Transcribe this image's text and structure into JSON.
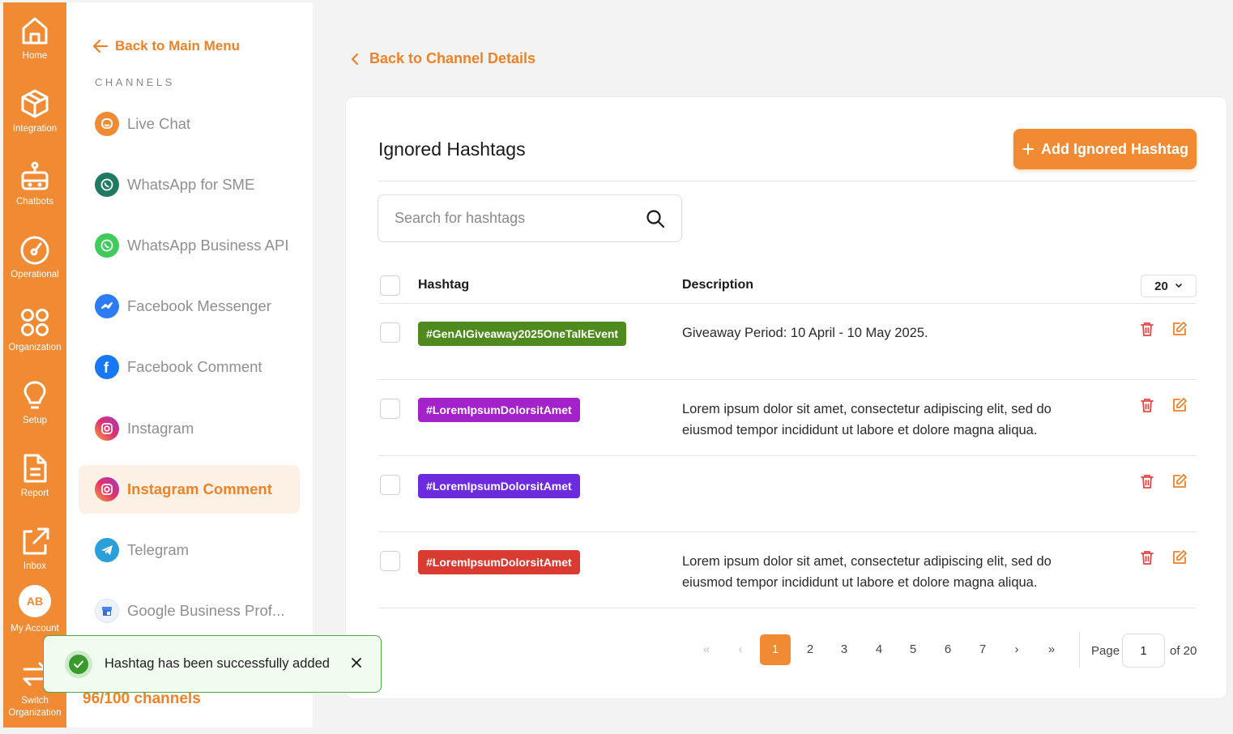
{
  "rail": {
    "items": [
      {
        "label": "Home",
        "icon": "home-icon"
      },
      {
        "label": "Integration",
        "icon": "cube-icon"
      },
      {
        "label": "Chatbots",
        "icon": "robot-icon"
      },
      {
        "label": "Operational",
        "icon": "gauge-icon"
      },
      {
        "label": "Organization",
        "icon": "circles-icon"
      },
      {
        "label": "Setup",
        "icon": "lightbulb-icon"
      },
      {
        "label": "Report",
        "icon": "document-icon"
      },
      {
        "label": "Inbox",
        "icon": "external-link-icon"
      }
    ],
    "account": {
      "initials": "AB",
      "label": "My Account"
    },
    "switch_org": {
      "line1": "Switch",
      "line2": "Organization"
    }
  },
  "panel": {
    "back_label": "Back to Main Menu",
    "section_title": "CHANNELS",
    "channels": [
      {
        "label": "Live Chat",
        "icon": "live-chat-icon"
      },
      {
        "label": "WhatsApp for SME",
        "icon": "whatsapp-sme-icon"
      },
      {
        "label": "WhatsApp Business API",
        "icon": "whatsapp-api-icon"
      },
      {
        "label": "Facebook Messenger",
        "icon": "messenger-icon"
      },
      {
        "label": "Facebook Comment",
        "icon": "facebook-icon"
      },
      {
        "label": "Instagram",
        "icon": "instagram-icon"
      },
      {
        "label": "Instagram Comment",
        "icon": "instagram-comment-icon",
        "active": true
      },
      {
        "label": "Telegram",
        "icon": "telegram-icon"
      },
      {
        "label": "Google Business Prof...",
        "icon": "google-business-icon"
      }
    ],
    "channel_count": "96/100 channels"
  },
  "main": {
    "back_label": "Back to Channel Details",
    "title": "Ignored Hashtags",
    "add_button": "Add Ignored Hashtag",
    "search_placeholder": "Search for hashtags",
    "columns": {
      "hashtag": "Hashtag",
      "description": "Description"
    },
    "per_page": "20",
    "rows": [
      {
        "tag": "#GenAIGiveaway2025OneTalkEvent",
        "color": "#4f8a1e",
        "desc_line1": "Giveaway Period: 10 April - 10 May 2025.",
        "desc_line2": ""
      },
      {
        "tag": "#LoremIpsumDolorsitAmet",
        "color": "#a322c9",
        "desc_line1": "Lorem ipsum dolor sit amet, consectetur adipiscing elit, sed do",
        "desc_line2": "eiusmod tempor incididunt ut labore et dolore magna aliqua."
      },
      {
        "tag": "#LoremIpsumDolorsitAmet",
        "color": "#6d2be0",
        "desc_line1": "",
        "desc_line2": ""
      },
      {
        "tag": "#LoremIpsumDolorsitAmet",
        "color": "#d93a32",
        "desc_line1": "Lorem ipsum dolor sit amet, consectetur adipiscing elit, sed do",
        "desc_line2": "eiusmod tempor incididunt ut labore et dolore magna aliqua."
      }
    ],
    "pagination": {
      "pages": [
        "1",
        "2",
        "3",
        "4",
        "5",
        "6",
        "7"
      ],
      "current": "1",
      "page_label": "Page",
      "page_input": "1",
      "of_label": "of 20"
    }
  },
  "toast": {
    "message": "Hashtag has been successfully added"
  },
  "colors": {
    "accent": "#f08a33",
    "success": "#3a9a2d"
  }
}
